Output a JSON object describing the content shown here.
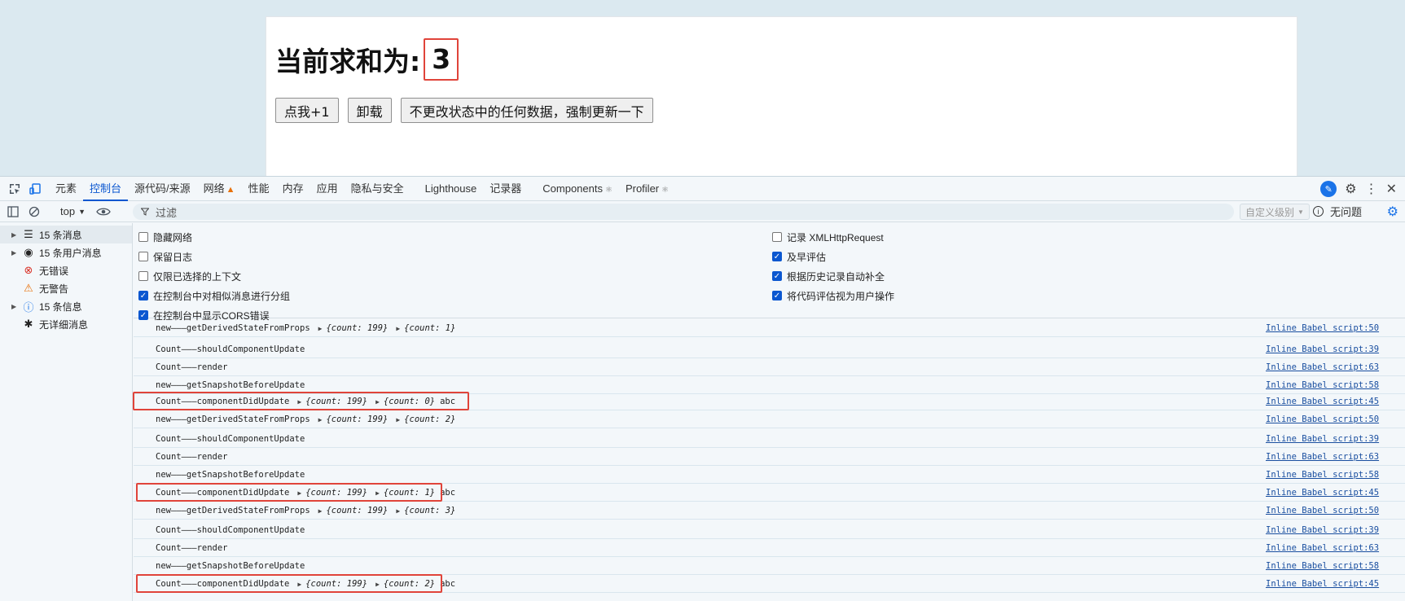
{
  "page": {
    "sum_label": "当前求和为:",
    "sum_value": "3",
    "buttons": [
      "点我+1",
      "卸载",
      "不更改状态中的任何数据，强制更新一下"
    ]
  },
  "devtools": {
    "tabs": [
      "元素",
      "控制台",
      "源代码/来源",
      "网络",
      "性能",
      "内存",
      "应用",
      "隐私与安全",
      "Lighthouse",
      "记录器",
      "Components",
      "Profiler"
    ],
    "active_tab": "控制台",
    "context": "top",
    "filter_placeholder": "过滤",
    "levels": "自定义级别",
    "issues": "无问题",
    "sidebar": [
      {
        "label": "15 条消息",
        "icon": "list-icon"
      },
      {
        "label": "15 条用户消息",
        "icon": "user-icon"
      },
      {
        "label": "无错误",
        "icon": "error-icon"
      },
      {
        "label": "无警告",
        "icon": "warning-icon"
      },
      {
        "label": "15 条信息",
        "icon": "info-icon"
      },
      {
        "label": "无详细消息",
        "icon": "bug-icon"
      }
    ],
    "settings_left": [
      {
        "label": "隐藏网络",
        "checked": false
      },
      {
        "label": "保留日志",
        "checked": false
      },
      {
        "label": "仅限已选择的上下文",
        "checked": false
      },
      {
        "label": "在控制台中对相似消息进行分组",
        "checked": true
      },
      {
        "label": "在控制台中显示CORS错误",
        "checked": true
      }
    ],
    "settings_right": [
      {
        "label": "记录 XMLHttpRequest",
        "checked": false
      },
      {
        "label": "及早评估",
        "checked": true
      },
      {
        "label": "根据历史记录自动补全",
        "checked": true
      },
      {
        "label": "将代码评估视为用户操作",
        "checked": true
      }
    ],
    "logs": [
      {
        "text": "new———getDerivedStateFromProps",
        "objs": [
          "{count: 199}",
          "{count: 1}"
        ],
        "extra": "",
        "src": "Inline Babel script:50"
      },
      {
        "text": "Count———shouldComponentUpdate",
        "objs": [],
        "extra": "",
        "src": "Inline Babel script:39"
      },
      {
        "text": "Count———render",
        "objs": [],
        "extra": "",
        "src": "Inline Babel script:63"
      },
      {
        "text": "new———getSnapshotBeforeUpdate",
        "objs": [],
        "extra": "",
        "src": "Inline Babel script:58"
      },
      {
        "text": "Count———componentDidUpdate",
        "objs": [
          "{count: 199}",
          "{count: 0}"
        ],
        "extra": "abc",
        "src": "Inline Babel script:45"
      },
      {
        "text": "new———getDerivedStateFromProps",
        "objs": [
          "{count: 199}",
          "{count: 2}"
        ],
        "extra": "",
        "src": "Inline Babel script:50"
      },
      {
        "text": "Count———shouldComponentUpdate",
        "objs": [],
        "extra": "",
        "src": "Inline Babel script:39"
      },
      {
        "text": "Count———render",
        "objs": [],
        "extra": "",
        "src": "Inline Babel script:63"
      },
      {
        "text": "new———getSnapshotBeforeUpdate",
        "objs": [],
        "extra": "",
        "src": "Inline Babel script:58"
      },
      {
        "text": "Count———componentDidUpdate",
        "objs": [
          "{count: 199}",
          "{count: 1}"
        ],
        "extra": "abc",
        "src": "Inline Babel script:45"
      },
      {
        "text": "new———getDerivedStateFromProps",
        "objs": [
          "{count: 199}",
          "{count: 3}"
        ],
        "extra": "",
        "src": "Inline Babel script:50"
      },
      {
        "text": "Count———shouldComponentUpdate",
        "objs": [],
        "extra": "",
        "src": "Inline Babel script:39"
      },
      {
        "text": "Count———render",
        "objs": [],
        "extra": "",
        "src": "Inline Babel script:63"
      },
      {
        "text": "new———getSnapshotBeforeUpdate",
        "objs": [],
        "extra": "",
        "src": "Inline Babel script:58"
      },
      {
        "text": "Count———componentDidUpdate",
        "objs": [
          "{count: 199}",
          "{count: 2}"
        ],
        "extra": "abc",
        "src": "Inline Babel script:45"
      }
    ]
  }
}
